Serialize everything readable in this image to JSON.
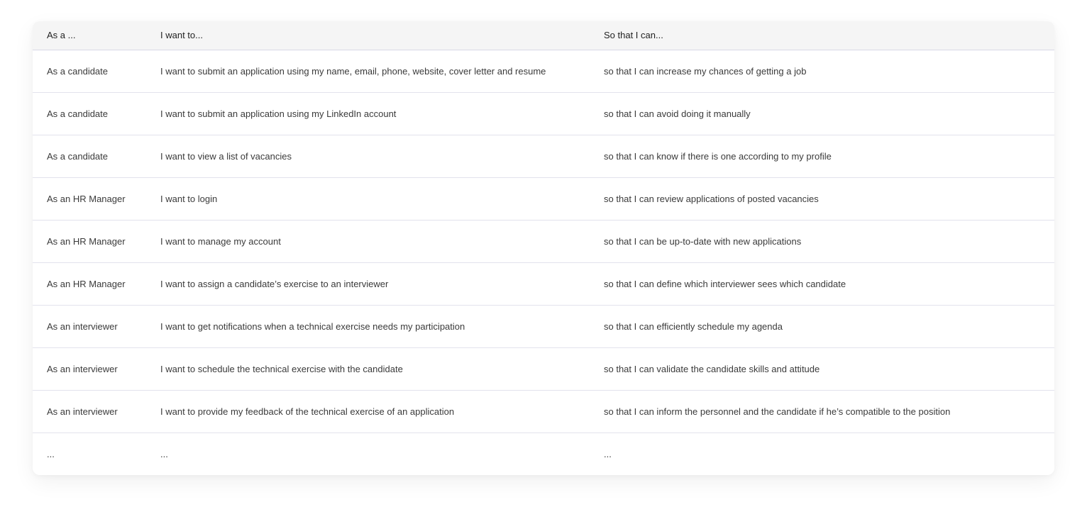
{
  "table": {
    "headers": [
      "As a ...",
      "I want to...",
      "So that I can..."
    ],
    "rows": [
      [
        "As a candidate",
        "I want to submit an application using my name, email, phone, website, cover letter and resume",
        "so that I can increase my chances of getting a job"
      ],
      [
        "As a candidate",
        "I want to submit an application using my LinkedIn account",
        "so that I can avoid doing it manually"
      ],
      [
        "As a candidate",
        "I want to view a list of vacancies",
        "so that I can know if there is one according to my profile"
      ],
      [
        "As an HR Manager",
        "I want to login",
        "so that I can review applications of posted vacancies"
      ],
      [
        "As an HR Manager",
        "I want to manage my account",
        "so that I can be up-to-date with new applications"
      ],
      [
        "As an HR Manager",
        "I want to assign a candidate’s exercise to an interviewer",
        "so that I can define which interviewer sees which candidate"
      ],
      [
        "As an interviewer",
        "I want to get notifications when a technical exercise needs my participation",
        "so that I can efficiently schedule my agenda"
      ],
      [
        "As an interviewer",
        "I want to schedule the technical exercise with the candidate",
        "so that I can validate the candidate skills and attitude"
      ],
      [
        "As an interviewer",
        "I want to provide my feedback of the technical exercise of an application",
        "so that I can inform the personnel and the candidate if he’s compatible to the position"
      ],
      [
        "...",
        "...",
        "..."
      ]
    ]
  },
  "colors": {
    "header_background": "#f5f5f5",
    "row_divider": "#e2e2ec",
    "text": "#3a3a3a"
  }
}
